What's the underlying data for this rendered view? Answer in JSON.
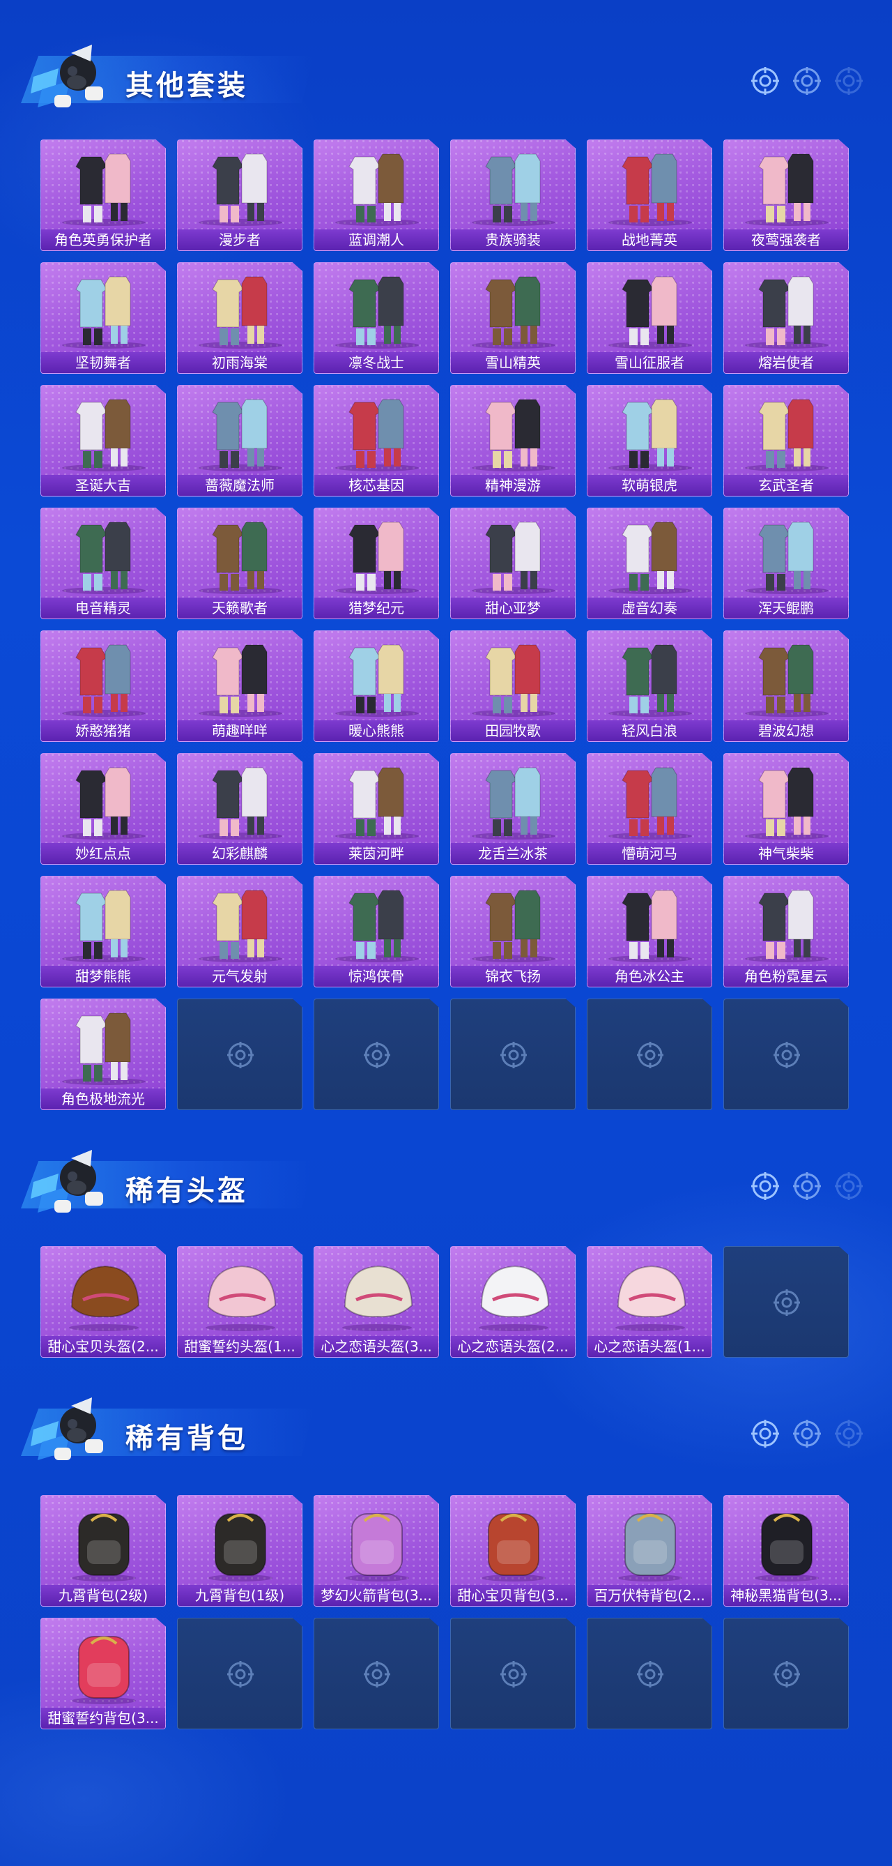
{
  "sections": [
    {
      "title": "其他套装",
      "items": [
        {
          "label": "角色英勇保护者",
          "icon": "armored-robot-costume-icon"
        },
        {
          "label": "漫步者",
          "icon": "dark-outfit-icon"
        },
        {
          "label": "蓝调潮人",
          "icon": "hooded-outfit-icon"
        },
        {
          "label": "贵族骑装",
          "icon": "noble-outfit-icon"
        },
        {
          "label": "战地菁英",
          "icon": "striped-outfit-icon"
        },
        {
          "label": "夜莺强袭者",
          "icon": "leather-outfit-icon"
        },
        {
          "label": "坚韧舞者",
          "icon": "white-outfit-icon"
        },
        {
          "label": "初雨海棠",
          "icon": "pink-outfit-icon"
        },
        {
          "label": "凛冬战士",
          "icon": "winter-outfit-icon"
        },
        {
          "label": "雪山精英",
          "icon": "green-outfit-icon"
        },
        {
          "label": "雪山征服者",
          "icon": "red-black-outfit-icon"
        },
        {
          "label": "熔岩使者",
          "icon": "lava-outfit-icon"
        },
        {
          "label": "圣诞大吉",
          "icon": "christmas-outfit-icon"
        },
        {
          "label": "蔷薇魔法师",
          "icon": "rose-mage-outfit-icon"
        },
        {
          "label": "核芯基因",
          "icon": "core-gene-outfit-icon"
        },
        {
          "label": "精神漫游",
          "icon": "wanderer-outfit-icon"
        },
        {
          "label": "软萌银虎",
          "icon": "tiger-outfit-icon"
        },
        {
          "label": "玄武圣者",
          "icon": "jade-outfit-icon"
        },
        {
          "label": "电音精灵",
          "icon": "electro-outfit-icon"
        },
        {
          "label": "天籁歌者",
          "icon": "singer-outfit-icon"
        },
        {
          "label": "猎梦纪元",
          "icon": "dream-outfit-icon"
        },
        {
          "label": "甜心亚梦",
          "icon": "sweetheart-outfit-icon"
        },
        {
          "label": "虚音幻奏",
          "icon": "virtual-outfit-icon"
        },
        {
          "label": "浑天鲲鹏",
          "icon": "kunpeng-outfit-icon"
        },
        {
          "label": "娇憨猪猪",
          "icon": "piggy-outfit-icon"
        },
        {
          "label": "萌趣咩咩",
          "icon": "sheep-outfit-icon"
        },
        {
          "label": "暖心熊熊",
          "icon": "bear-outfit-icon"
        },
        {
          "label": "田园牧歌",
          "icon": "pastoral-outfit-icon"
        },
        {
          "label": "轻风白浪",
          "icon": "breeze-outfit-icon"
        },
        {
          "label": "碧波幻想",
          "icon": "wave-outfit-icon"
        },
        {
          "label": "妙红点点",
          "icon": "red-dots-outfit-icon"
        },
        {
          "label": "幻彩麒麟",
          "icon": "kirin-outfit-icon"
        },
        {
          "label": "莱茵河畔",
          "icon": "rhine-outfit-icon"
        },
        {
          "label": "龙舌兰冰茶",
          "icon": "tequila-outfit-icon"
        },
        {
          "label": "懵萌河马",
          "icon": "hippo-outfit-icon"
        },
        {
          "label": "神气柴柴",
          "icon": "shiba-outfit-icon"
        },
        {
          "label": "甜梦熊熊",
          "icon": "dream-bear-outfit-icon"
        },
        {
          "label": "元气发射",
          "icon": "energy-outfit-icon"
        },
        {
          "label": "惊鸿侠骨",
          "icon": "swordsman-outfit-icon"
        },
        {
          "label": "锦衣飞扬",
          "icon": "brocade-outfit-icon"
        },
        {
          "label": "角色冰公主",
          "icon": "ice-princess-character-icon"
        },
        {
          "label": "角色粉霓星云",
          "icon": "pink-nebula-character-icon"
        },
        {
          "label": "角色极地流光",
          "icon": "polar-light-character-icon"
        }
      ],
      "empty_slots": 5
    },
    {
      "title": "稀有头盔",
      "items": [
        {
          "label": "甜心宝贝头盔(2...",
          "icon": "cake-helmet-icon"
        },
        {
          "label": "甜蜜誓约头盔(1...",
          "icon": "pink-helmet-icon"
        },
        {
          "label": "心之恋语头盔(3...",
          "icon": "heart-helmet-lv3-icon"
        },
        {
          "label": "心之恋语头盔(2...",
          "icon": "heart-helmet-lv2-icon"
        },
        {
          "label": "心之恋语头盔(1...",
          "icon": "heart-helmet-lv1-icon"
        }
      ],
      "empty_slots": 1
    },
    {
      "title": "稀有背包",
      "items": [
        {
          "label": "九霄背包(2级)",
          "icon": "gold-backpack-lv2-icon"
        },
        {
          "label": "九霄背包(1级)",
          "icon": "gold-backpack-lv1-icon"
        },
        {
          "label": "梦幻火箭背包(3...",
          "icon": "rocket-backpack-icon"
        },
        {
          "label": "甜心宝贝背包(3...",
          "icon": "cake-backpack-icon"
        },
        {
          "label": "百万伏特背包(2...",
          "icon": "volt-backpack-icon"
        },
        {
          "label": "神秘黑猫背包(3...",
          "icon": "black-cat-backpack-icon"
        },
        {
          "label": "甜蜜誓约背包(3...",
          "icon": "bow-backpack-icon"
        }
      ],
      "empty_slots": 5
    }
  ],
  "colors": {
    "background": "#0b45d2",
    "card_purple": "#a55ce0",
    "label_purple": "#5b22b0",
    "empty_slot": "#1f3f7d"
  }
}
